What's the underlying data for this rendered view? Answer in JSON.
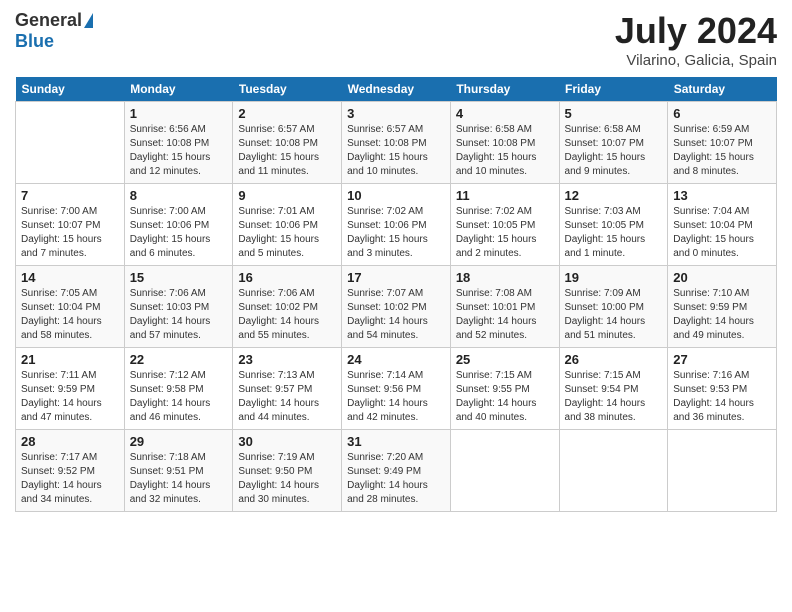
{
  "header": {
    "logo_general": "General",
    "logo_blue": "Blue",
    "title": "July 2024",
    "subtitle": "Vilarino, Galicia, Spain"
  },
  "calendar": {
    "weekdays": [
      "Sunday",
      "Monday",
      "Tuesday",
      "Wednesday",
      "Thursday",
      "Friday",
      "Saturday"
    ],
    "weeks": [
      [
        {
          "day": "",
          "sunrise": "",
          "sunset": "",
          "daylight": ""
        },
        {
          "day": "1",
          "sunrise": "Sunrise: 6:56 AM",
          "sunset": "Sunset: 10:08 PM",
          "daylight": "Daylight: 15 hours and 12 minutes."
        },
        {
          "day": "2",
          "sunrise": "Sunrise: 6:57 AM",
          "sunset": "Sunset: 10:08 PM",
          "daylight": "Daylight: 15 hours and 11 minutes."
        },
        {
          "day": "3",
          "sunrise": "Sunrise: 6:57 AM",
          "sunset": "Sunset: 10:08 PM",
          "daylight": "Daylight: 15 hours and 10 minutes."
        },
        {
          "day": "4",
          "sunrise": "Sunrise: 6:58 AM",
          "sunset": "Sunset: 10:08 PM",
          "daylight": "Daylight: 15 hours and 10 minutes."
        },
        {
          "day": "5",
          "sunrise": "Sunrise: 6:58 AM",
          "sunset": "Sunset: 10:07 PM",
          "daylight": "Daylight: 15 hours and 9 minutes."
        },
        {
          "day": "6",
          "sunrise": "Sunrise: 6:59 AM",
          "sunset": "Sunset: 10:07 PM",
          "daylight": "Daylight: 15 hours and 8 minutes."
        }
      ],
      [
        {
          "day": "7",
          "sunrise": "Sunrise: 7:00 AM",
          "sunset": "Sunset: 10:07 PM",
          "daylight": "Daylight: 15 hours and 7 minutes."
        },
        {
          "day": "8",
          "sunrise": "Sunrise: 7:00 AM",
          "sunset": "Sunset: 10:06 PM",
          "daylight": "Daylight: 15 hours and 6 minutes."
        },
        {
          "day": "9",
          "sunrise": "Sunrise: 7:01 AM",
          "sunset": "Sunset: 10:06 PM",
          "daylight": "Daylight: 15 hours and 5 minutes."
        },
        {
          "day": "10",
          "sunrise": "Sunrise: 7:02 AM",
          "sunset": "Sunset: 10:06 PM",
          "daylight": "Daylight: 15 hours and 3 minutes."
        },
        {
          "day": "11",
          "sunrise": "Sunrise: 7:02 AM",
          "sunset": "Sunset: 10:05 PM",
          "daylight": "Daylight: 15 hours and 2 minutes."
        },
        {
          "day": "12",
          "sunrise": "Sunrise: 7:03 AM",
          "sunset": "Sunset: 10:05 PM",
          "daylight": "Daylight: 15 hours and 1 minute."
        },
        {
          "day": "13",
          "sunrise": "Sunrise: 7:04 AM",
          "sunset": "Sunset: 10:04 PM",
          "daylight": "Daylight: 15 hours and 0 minutes."
        }
      ],
      [
        {
          "day": "14",
          "sunrise": "Sunrise: 7:05 AM",
          "sunset": "Sunset: 10:04 PM",
          "daylight": "Daylight: 14 hours and 58 minutes."
        },
        {
          "day": "15",
          "sunrise": "Sunrise: 7:06 AM",
          "sunset": "Sunset: 10:03 PM",
          "daylight": "Daylight: 14 hours and 57 minutes."
        },
        {
          "day": "16",
          "sunrise": "Sunrise: 7:06 AM",
          "sunset": "Sunset: 10:02 PM",
          "daylight": "Daylight: 14 hours and 55 minutes."
        },
        {
          "day": "17",
          "sunrise": "Sunrise: 7:07 AM",
          "sunset": "Sunset: 10:02 PM",
          "daylight": "Daylight: 14 hours and 54 minutes."
        },
        {
          "day": "18",
          "sunrise": "Sunrise: 7:08 AM",
          "sunset": "Sunset: 10:01 PM",
          "daylight": "Daylight: 14 hours and 52 minutes."
        },
        {
          "day": "19",
          "sunrise": "Sunrise: 7:09 AM",
          "sunset": "Sunset: 10:00 PM",
          "daylight": "Daylight: 14 hours and 51 minutes."
        },
        {
          "day": "20",
          "sunrise": "Sunrise: 7:10 AM",
          "sunset": "Sunset: 9:59 PM",
          "daylight": "Daylight: 14 hours and 49 minutes."
        }
      ],
      [
        {
          "day": "21",
          "sunrise": "Sunrise: 7:11 AM",
          "sunset": "Sunset: 9:59 PM",
          "daylight": "Daylight: 14 hours and 47 minutes."
        },
        {
          "day": "22",
          "sunrise": "Sunrise: 7:12 AM",
          "sunset": "Sunset: 9:58 PM",
          "daylight": "Daylight: 14 hours and 46 minutes."
        },
        {
          "day": "23",
          "sunrise": "Sunrise: 7:13 AM",
          "sunset": "Sunset: 9:57 PM",
          "daylight": "Daylight: 14 hours and 44 minutes."
        },
        {
          "day": "24",
          "sunrise": "Sunrise: 7:14 AM",
          "sunset": "Sunset: 9:56 PM",
          "daylight": "Daylight: 14 hours and 42 minutes."
        },
        {
          "day": "25",
          "sunrise": "Sunrise: 7:15 AM",
          "sunset": "Sunset: 9:55 PM",
          "daylight": "Daylight: 14 hours and 40 minutes."
        },
        {
          "day": "26",
          "sunrise": "Sunrise: 7:15 AM",
          "sunset": "Sunset: 9:54 PM",
          "daylight": "Daylight: 14 hours and 38 minutes."
        },
        {
          "day": "27",
          "sunrise": "Sunrise: 7:16 AM",
          "sunset": "Sunset: 9:53 PM",
          "daylight": "Daylight: 14 hours and 36 minutes."
        }
      ],
      [
        {
          "day": "28",
          "sunrise": "Sunrise: 7:17 AM",
          "sunset": "Sunset: 9:52 PM",
          "daylight": "Daylight: 14 hours and 34 minutes."
        },
        {
          "day": "29",
          "sunrise": "Sunrise: 7:18 AM",
          "sunset": "Sunset: 9:51 PM",
          "daylight": "Daylight: 14 hours and 32 minutes."
        },
        {
          "day": "30",
          "sunrise": "Sunrise: 7:19 AM",
          "sunset": "Sunset: 9:50 PM",
          "daylight": "Daylight: 14 hours and 30 minutes."
        },
        {
          "day": "31",
          "sunrise": "Sunrise: 7:20 AM",
          "sunset": "Sunset: 9:49 PM",
          "daylight": "Daylight: 14 hours and 28 minutes."
        },
        {
          "day": "",
          "sunrise": "",
          "sunset": "",
          "daylight": ""
        },
        {
          "day": "",
          "sunrise": "",
          "sunset": "",
          "daylight": ""
        },
        {
          "day": "",
          "sunrise": "",
          "sunset": "",
          "daylight": ""
        }
      ]
    ]
  }
}
